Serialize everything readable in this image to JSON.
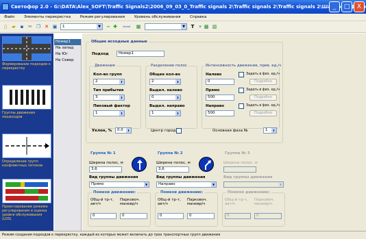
{
  "window": {
    "title": "Светофор 2.0 - G:\\DATA\\Alex_SOFT\\Traffic Signals2\\2006_09_03_0_Traffic signals 2\\Traffic signals 2\\Traffic signals 2\\Шаблона (Дорожная\\И...",
    "minimize": "_",
    "maximize": "□",
    "close": "X"
  },
  "menu": [
    "Файл",
    "Элементы перекрестка",
    "Режим регулирования",
    "Уровень обслуживания",
    "Справка"
  ],
  "toolbar": {
    "combo1_value": "1",
    "combo2_value": "",
    "combo3_value": "",
    "arrows_label": "⇦⇨"
  },
  "sidebar": [
    {
      "label": "Формирование подходов к перекрестку"
    },
    {
      "label": "Группы движения пешеходов"
    },
    {
      "label": "Определение групп конфликтных потоков"
    },
    {
      "label": "Проектирование режима регулирования и оценка уровня обслуживания (LOS)"
    }
  ],
  "approaches": [
    "Номер1",
    "На запад",
    "На Юг",
    "На Север"
  ],
  "general": {
    "title": "Общие исходные данные",
    "approach_label": "Подход",
    "approach_value": "Номер1",
    "movement": {
      "title": "Движение",
      "lanes_label": "Кол-во групп",
      "lanes_value": "2",
      "arrival_label": "Тип прибытия",
      "arrival_value": "3",
      "peak_label": "Пиковый фактор",
      "peak_value": "1"
    },
    "lanes": {
      "title": "Разделение полос",
      "total_label": "Общее кол-во",
      "total_value": "2",
      "left_label": "Выдел. налево",
      "left_value": "0",
      "right_label": "Выдел. направо",
      "right_value": "1"
    },
    "intensity": {
      "title": "Интенсивность движения, прив. ед./ч",
      "left_label": "Налево",
      "left_value": "0",
      "straight_label": "Прямо",
      "straight_value": "500",
      "right_label": "Направо",
      "right_value": "500",
      "set_fact": "Задать в физ. ед./ч",
      "details": "Подробно"
    },
    "slope_label": "Уклон, %",
    "slope_value": "0.0",
    "city_center": "Центр города",
    "main_phase_label": "Основная фаза №",
    "main_phase_value": "1"
  },
  "groups": [
    {
      "title": "Группа № 1",
      "width_label": "Ширина полос, м",
      "width_value": "3,6",
      "type_label": "Вид группы движения",
      "type_value": "Прямо",
      "hindrance_title": "Помехи движению:",
      "trucks_label": "Общ-й тр-т, авт/ч",
      "trucks_value": "0",
      "parking_label": "Парковоч. маневр/ч",
      "parking_value": "0"
    },
    {
      "title": "Группа № 2",
      "width_label": "Ширина полос, м",
      "width_value": "3,6",
      "type_label": "Вид группы движения",
      "type_value": "Направо",
      "hindrance_title": "Помехи движению:",
      "trucks_label": "Общ-й тр-т, авт/ч",
      "trucks_value": "0",
      "parking_label": "Парковоч. маневр/ч",
      "parking_value": "0"
    },
    {
      "title": "Группа № 3",
      "width_label": "Ширина полос, м",
      "width_value": "",
      "type_label": "Вид группы движения",
      "type_value": "",
      "hindrance_title": "Помехи движению:",
      "trucks_label": "Общ-й тр-т, авт/ч",
      "trucks_value": "0",
      "parking_label": "Парковоч. маневр/ч",
      "parking_value": "0"
    }
  ],
  "status": "Режим создания подходов к перекрестку, каждый из которых может включать до трех транспортных групп движения",
  "colors": {
    "title_bar": "#1654d6",
    "sidebar": "#1a3a8f",
    "accent_text": "#ffd24a"
  }
}
